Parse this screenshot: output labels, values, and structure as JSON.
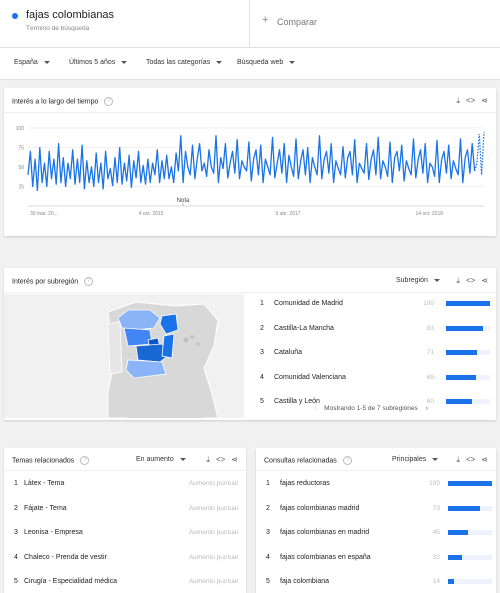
{
  "search": {
    "term": "fajas colombianas",
    "term_type": "Término de búsqueda",
    "compare_label": "Comparar",
    "term_color": "#1a73e8"
  },
  "filters": {
    "country": "España",
    "period": "Últimos 5 años",
    "category": "Todas las categorías",
    "search_type": "Búsqueda web"
  },
  "interest_over_time": {
    "title": "Interés a lo largo del tiempo",
    "note_label": "Nota",
    "chart_data": {
      "type": "line",
      "title": "Interés a lo largo del tiempo",
      "y_ticks": [
        100,
        75,
        50,
        25
      ],
      "ylim": [
        0,
        100
      ],
      "x_tick_labels": [
        "30 mar. 20...",
        "4 oct. 2015",
        "9 abr. 2017",
        "14 oct. 2018"
      ],
      "grid": true,
      "series": [
        {
          "color": "#1a73e8",
          "values": [
            40,
            70,
            25,
            60,
            20,
            75,
            30,
            55,
            25,
            70,
            35,
            60,
            28,
            80,
            30,
            62,
            25,
            55,
            35,
            72,
            28,
            60,
            30,
            78,
            22,
            58,
            30,
            50,
            25,
            68,
            30,
            55,
            22,
            70,
            35,
            48,
            26,
            62,
            30,
            75,
            28,
            55,
            32,
            65,
            24,
            58,
            36,
            70,
            30,
            52,
            28,
            60,
            30,
            55,
            40,
            72,
            30,
            58,
            35,
            65,
            35,
            50,
            30,
            68,
            45,
            90,
            30,
            70,
            50,
            40,
            78,
            35,
            60,
            80,
            45,
            55,
            38,
            72,
            50,
            42,
            90,
            30,
            62,
            48,
            80,
            36,
            55,
            70,
            42,
            85,
            35,
            58,
            50,
            45,
            82,
            32,
            60,
            72,
            40,
            78,
            30,
            60,
            50,
            40,
            88,
            36,
            55,
            72,
            42,
            80,
            30,
            65,
            50,
            38,
            86,
            35,
            58,
            72,
            40,
            75,
            30,
            62,
            50,
            40,
            90,
            35,
            60,
            70,
            42,
            80,
            30,
            58,
            48,
            40,
            76,
            36,
            62,
            70,
            40,
            85,
            30,
            55,
            48,
            42,
            80,
            34,
            60,
            72,
            40,
            88,
            35,
            58,
            50,
            38,
            82,
            30,
            62,
            70,
            45,
            78,
            32,
            58,
            48,
            40,
            86,
            36,
            60,
            72,
            42,
            80,
            30,
            55,
            50,
            38,
            84,
            30,
            60,
            70,
            42,
            78,
            35,
            58,
            48,
            40,
            86,
            30,
            62,
            72,
            42,
            80,
            45,
            55,
            92,
            40,
            95
          ]
        }
      ]
    }
  },
  "interest_by_region": {
    "title": "Interés por subregión",
    "selector": "Subregión",
    "pagination": "Mostrando 1-5 de 7 subregiones",
    "rows": [
      {
        "rank": "1",
        "name": "Comunidad de Madrid",
        "value": 100
      },
      {
        "rank": "2",
        "name": "Castilla-La Mancha",
        "value": 83
      },
      {
        "rank": "3",
        "name": "Cataluña",
        "value": 71
      },
      {
        "rank": "4",
        "name": "Comunidad Valenciana",
        "value": 69
      },
      {
        "rank": "5",
        "name": "Castilla y León",
        "value": 60
      }
    ]
  },
  "related_topics": {
    "title": "Temas relacionados",
    "selector": "En aumento",
    "rows": [
      {
        "rank": "1",
        "name": "Látex - Tema",
        "value": "Aumento puntual"
      },
      {
        "rank": "2",
        "name": "Fájate - Tema",
        "value": "Aumento puntual"
      },
      {
        "rank": "3",
        "name": "Leonisa - Empresa",
        "value": "Aumento puntual"
      },
      {
        "rank": "4",
        "name": "Chaleco - Prenda de vestir",
        "value": "Aumento puntual"
      },
      {
        "rank": "5",
        "name": "Cirugía - Especialidad médica",
        "value": "Aumento puntual"
      }
    ]
  },
  "related_queries": {
    "title": "Consultas relacionadas",
    "selector": "Principales",
    "rows": [
      {
        "rank": "1",
        "name": "fajas reductoras",
        "value": 100
      },
      {
        "rank": "2",
        "name": "fajas colombianas madrid",
        "value": 73
      },
      {
        "rank": "3",
        "name": "fajas colombianas en madrid",
        "value": 45
      },
      {
        "rank": "4",
        "name": "fajas colombianas en españa",
        "value": 32
      },
      {
        "rank": "5",
        "name": "faja colombiana",
        "value": 14
      }
    ]
  },
  "icons": {
    "help": "help-circle-icon",
    "download": "download-icon",
    "embed": "embed-code-icon",
    "share": "share-icon",
    "add": "plus-icon",
    "prev": "chevron-left-icon",
    "next": "chevron-right-icon"
  }
}
